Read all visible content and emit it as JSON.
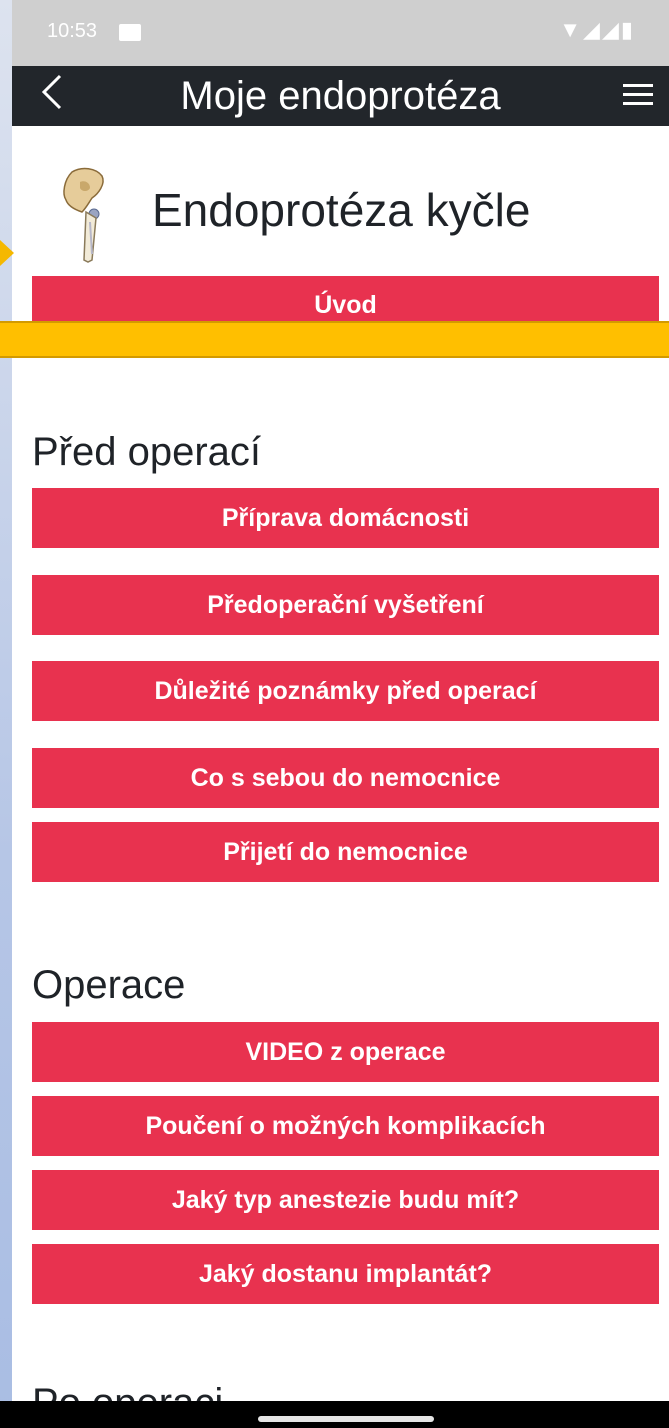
{
  "status_bar": {
    "time": "10:53",
    "icons": "▼◢◢▮"
  },
  "app_bar": {
    "back_glyph": "<",
    "title": "Moje endoprotéza"
  },
  "header": {
    "title": "Endoprotéza kyčle",
    "icon_name": "hip-joint-icon"
  },
  "intro_button": "Úvod",
  "sections": [
    {
      "title": "Před operací",
      "buttons": [
        "Příprava domácnosti",
        "Předoperační vyšetření",
        "Důležité poznámky před operací",
        "Co s sebou do nemocnice",
        "Přijetí do nemocnice"
      ]
    },
    {
      "title": "Operace",
      "buttons": [
        "VIDEO z operace",
        "Poučení o možných komplikacích",
        "Jaký typ anestezie budu mít?",
        "Jaký dostanu implantát?"
      ]
    },
    {
      "title": "Po operaci"
    }
  ],
  "colors": {
    "accent": "#e8324f",
    "app_bar": "#22262b",
    "highlight": "#ffbf00"
  }
}
